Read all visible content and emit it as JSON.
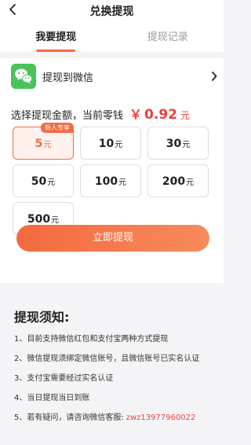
{
  "header": {
    "title": "兑换提现"
  },
  "tabs": [
    {
      "label": "我要提现",
      "active": true
    },
    {
      "label": "提现记录",
      "active": false
    }
  ],
  "method": {
    "label": "提现到微信",
    "icon": "wechat-icon"
  },
  "balance": {
    "label": "选择提现金额，当前零钱",
    "symbol": "￥",
    "value": "0.92",
    "unit": "元"
  },
  "amounts": [
    {
      "value": "5",
      "unit": "元",
      "badge": "新人专享",
      "selected": true
    },
    {
      "value": "10",
      "unit": "元"
    },
    {
      "value": "30",
      "unit": "元"
    },
    {
      "value": "50",
      "unit": "元"
    },
    {
      "value": "100",
      "unit": "元"
    },
    {
      "value": "200",
      "unit": "元"
    },
    {
      "value": "500",
      "unit": "元"
    }
  ],
  "withdraw_button": {
    "label": "立即提现"
  },
  "notice": {
    "title": "提现须知:",
    "rules": [
      "1、目前支持微信红包和支付宝两种方式提现",
      "2、微信提现须绑定微信账号，且微信账号已实名认证",
      "3、支付宝需要经过实名认证",
      "4、当日提现当日到账",
      "5、若有疑问，请咨询微信客服:"
    ],
    "contact": "zwz13977960022"
  },
  "colors": {
    "accent": "#f26b43",
    "price": "#f03c3c",
    "wechat": "#4bc35a"
  }
}
